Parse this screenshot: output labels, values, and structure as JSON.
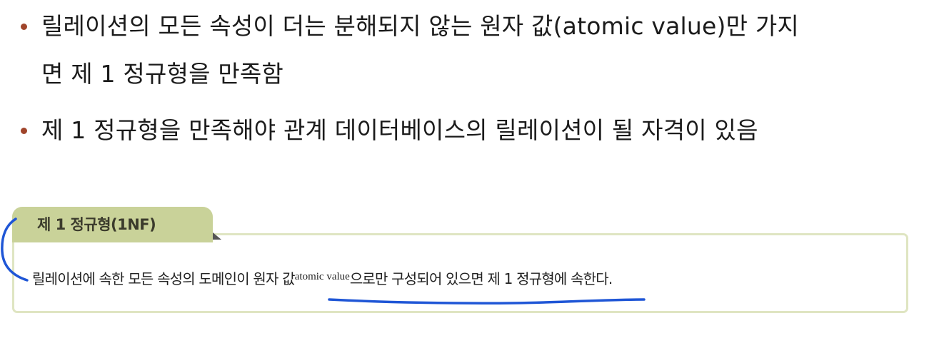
{
  "bullets": [
    {
      "lines": [
        "릴레이션의 모든 속성이 더는 분해되지 않는 원자 값(atomic value)만 가지",
        "면 제 1 정규형을 만족함"
      ]
    },
    {
      "lines": [
        "제 1 정규형을 만족해야 관계 데이터베이스의 릴레이션이 될 자격이 있음"
      ]
    }
  ],
  "definition": {
    "tab_label": "제 1 정규형(1NF)",
    "text_before": "릴레이션에 속한 모든 속성의 도메인이 원자 값",
    "text_sup": "atomic value",
    "text_after": "으로만 구성되어 있으면 제 1 정규형에 속한다."
  },
  "colors": {
    "bullet": "#a0452b",
    "tab_background": "#c9d299",
    "box_border": "#dfe5c2",
    "annotation_ink": "#1f56d6"
  }
}
